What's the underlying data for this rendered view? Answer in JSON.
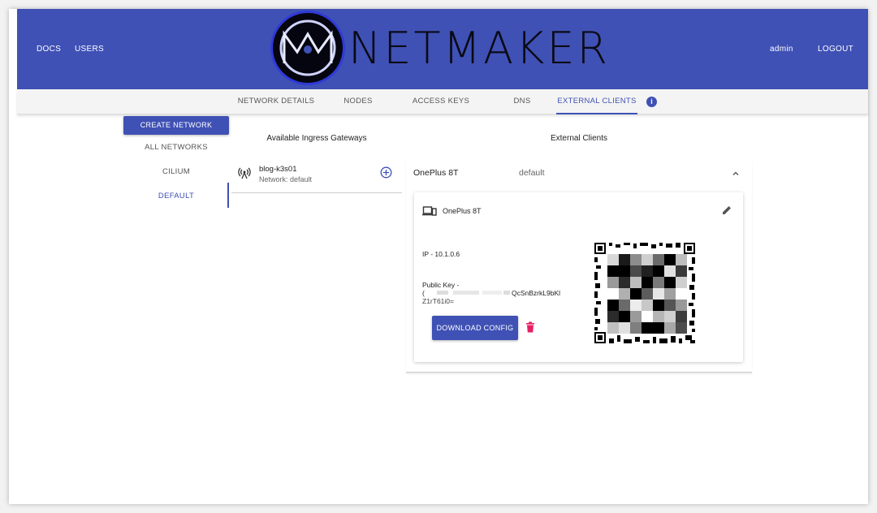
{
  "header": {
    "docs_label": "DOCS",
    "users_label": "USERS",
    "brand": "NETMAKER",
    "user_label": "admin",
    "logout_label": "LOGOUT",
    "color": "#3f51b5"
  },
  "tabs": [
    {
      "label": "NETWORK DETAILS"
    },
    {
      "label": "NODES"
    },
    {
      "label": "ACCESS KEYS"
    },
    {
      "label": "DNS"
    },
    {
      "label": "EXTERNAL CLIENTS",
      "active": true
    }
  ],
  "info_badge": "i",
  "sidebar": {
    "create_label": "CREATE NETWORK",
    "all_label": "ALL NETWORKS",
    "networks": [
      {
        "label": "CILIUM"
      },
      {
        "label": "DEFAULT",
        "active": true
      }
    ]
  },
  "gateways": {
    "title": "Available Ingress Gateways",
    "items": [
      {
        "name": "blog-k3s01",
        "network": "Network: default",
        "icon": "antenna-icon"
      }
    ]
  },
  "clients": {
    "title": "External Clients",
    "items": [
      {
        "name": "OnePlus 8T",
        "network": "default",
        "card_title": "OnePlus 8T",
        "ip": "IP - 10.1.0.6",
        "pk_label": "Public Key -",
        "pk_prefix": "(",
        "pk_visible": "QcSnBzrkL9bKl",
        "pk_line2": "Z1rT61i0=",
        "download_label": "DOWNLOAD CONFIG",
        "delete_color": "#e91e63"
      }
    ]
  }
}
